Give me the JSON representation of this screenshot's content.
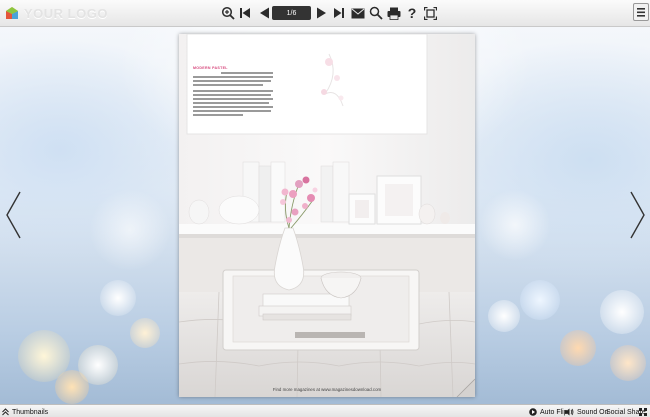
{
  "toolbar": {
    "logo_text": "YOUR LOGO",
    "page_indicator": "1/6",
    "icons": [
      "zoom-in-icon",
      "first-page-icon",
      "previous-page-icon",
      "next-page-icon",
      "last-page-icon",
      "email-icon",
      "search-icon",
      "print-icon",
      "help-icon",
      "fullscreen-icon",
      "menu-icon"
    ]
  },
  "page": {
    "heading": "MODERN PASTEL",
    "footer": "Find more magazines at www.magazinesdownload.com"
  },
  "bottom_bar": {
    "thumbnails_label": "Thumbnails",
    "auto_flip_label": "Auto Flip",
    "sound_label": "Sound On",
    "social_label": "Social Share"
  },
  "colors": {
    "accent_heading": "#d6457a",
    "toolbar_icon": "#2b2b2b"
  }
}
